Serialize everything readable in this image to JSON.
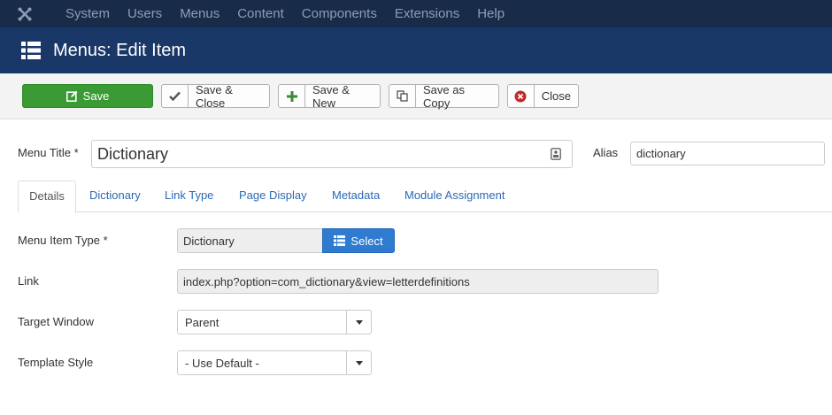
{
  "nav": {
    "items": [
      "System",
      "Users",
      "Menus",
      "Content",
      "Components",
      "Extensions",
      "Help"
    ]
  },
  "header": {
    "title": "Menus: Edit Item"
  },
  "toolbar": {
    "save": "Save",
    "save_close": "Save & Close",
    "save_new": "Save & New",
    "save_copy": "Save as Copy",
    "close": "Close"
  },
  "form": {
    "menu_title_label": "Menu Title *",
    "menu_title_value": "Dictionary",
    "alias_label": "Alias",
    "alias_value": "dictionary"
  },
  "tabs": [
    "Details",
    "Dictionary",
    "Link Type",
    "Page Display",
    "Metadata",
    "Module Assignment"
  ],
  "details": {
    "menu_item_type_label": "Menu Item Type *",
    "menu_item_type_value": "Dictionary",
    "select_button": "Select",
    "link_label": "Link",
    "link_value": "index.php?option=com_dictionary&view=letterdefinitions",
    "target_window_label": "Target Window",
    "target_window_value": "Parent",
    "template_style_label": "Template Style",
    "template_style_value": "- Use Default -"
  },
  "colors": {
    "navbar": "#182c4a",
    "header": "#1a3867",
    "save_green": "#3a9b35",
    "select_blue": "#2f7bd0",
    "link_blue": "#2a69b8"
  }
}
